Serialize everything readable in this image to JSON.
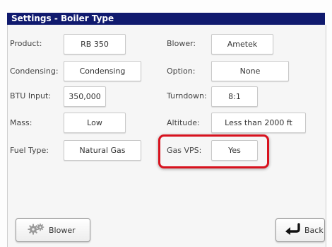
{
  "window": {
    "title": "Settings - Boiler Type"
  },
  "left_fields": [
    {
      "label": "Product:",
      "value": "RB 350"
    },
    {
      "label": "Condensing:",
      "value": "Condensing"
    },
    {
      "label": "BTU Input:",
      "value": "350,000"
    },
    {
      "label": "Mass:",
      "value": "Low"
    },
    {
      "label": "Fuel Type:",
      "value": "Natural Gas"
    }
  ],
  "right_fields": [
    {
      "label": "Blower:",
      "value": "Ametek"
    },
    {
      "label": "Option:",
      "value": "None"
    },
    {
      "label": "Turndown:",
      "value": "8:1"
    },
    {
      "label": "Altitude:",
      "value": "Less than 2000 ft"
    },
    {
      "label": "Gas VPS:",
      "value": "Yes"
    }
  ],
  "buttons": {
    "blower_label": "Blower",
    "back_label": "Back"
  },
  "highlight_color": "#d8121e",
  "titlebar_color": "#101a6e"
}
